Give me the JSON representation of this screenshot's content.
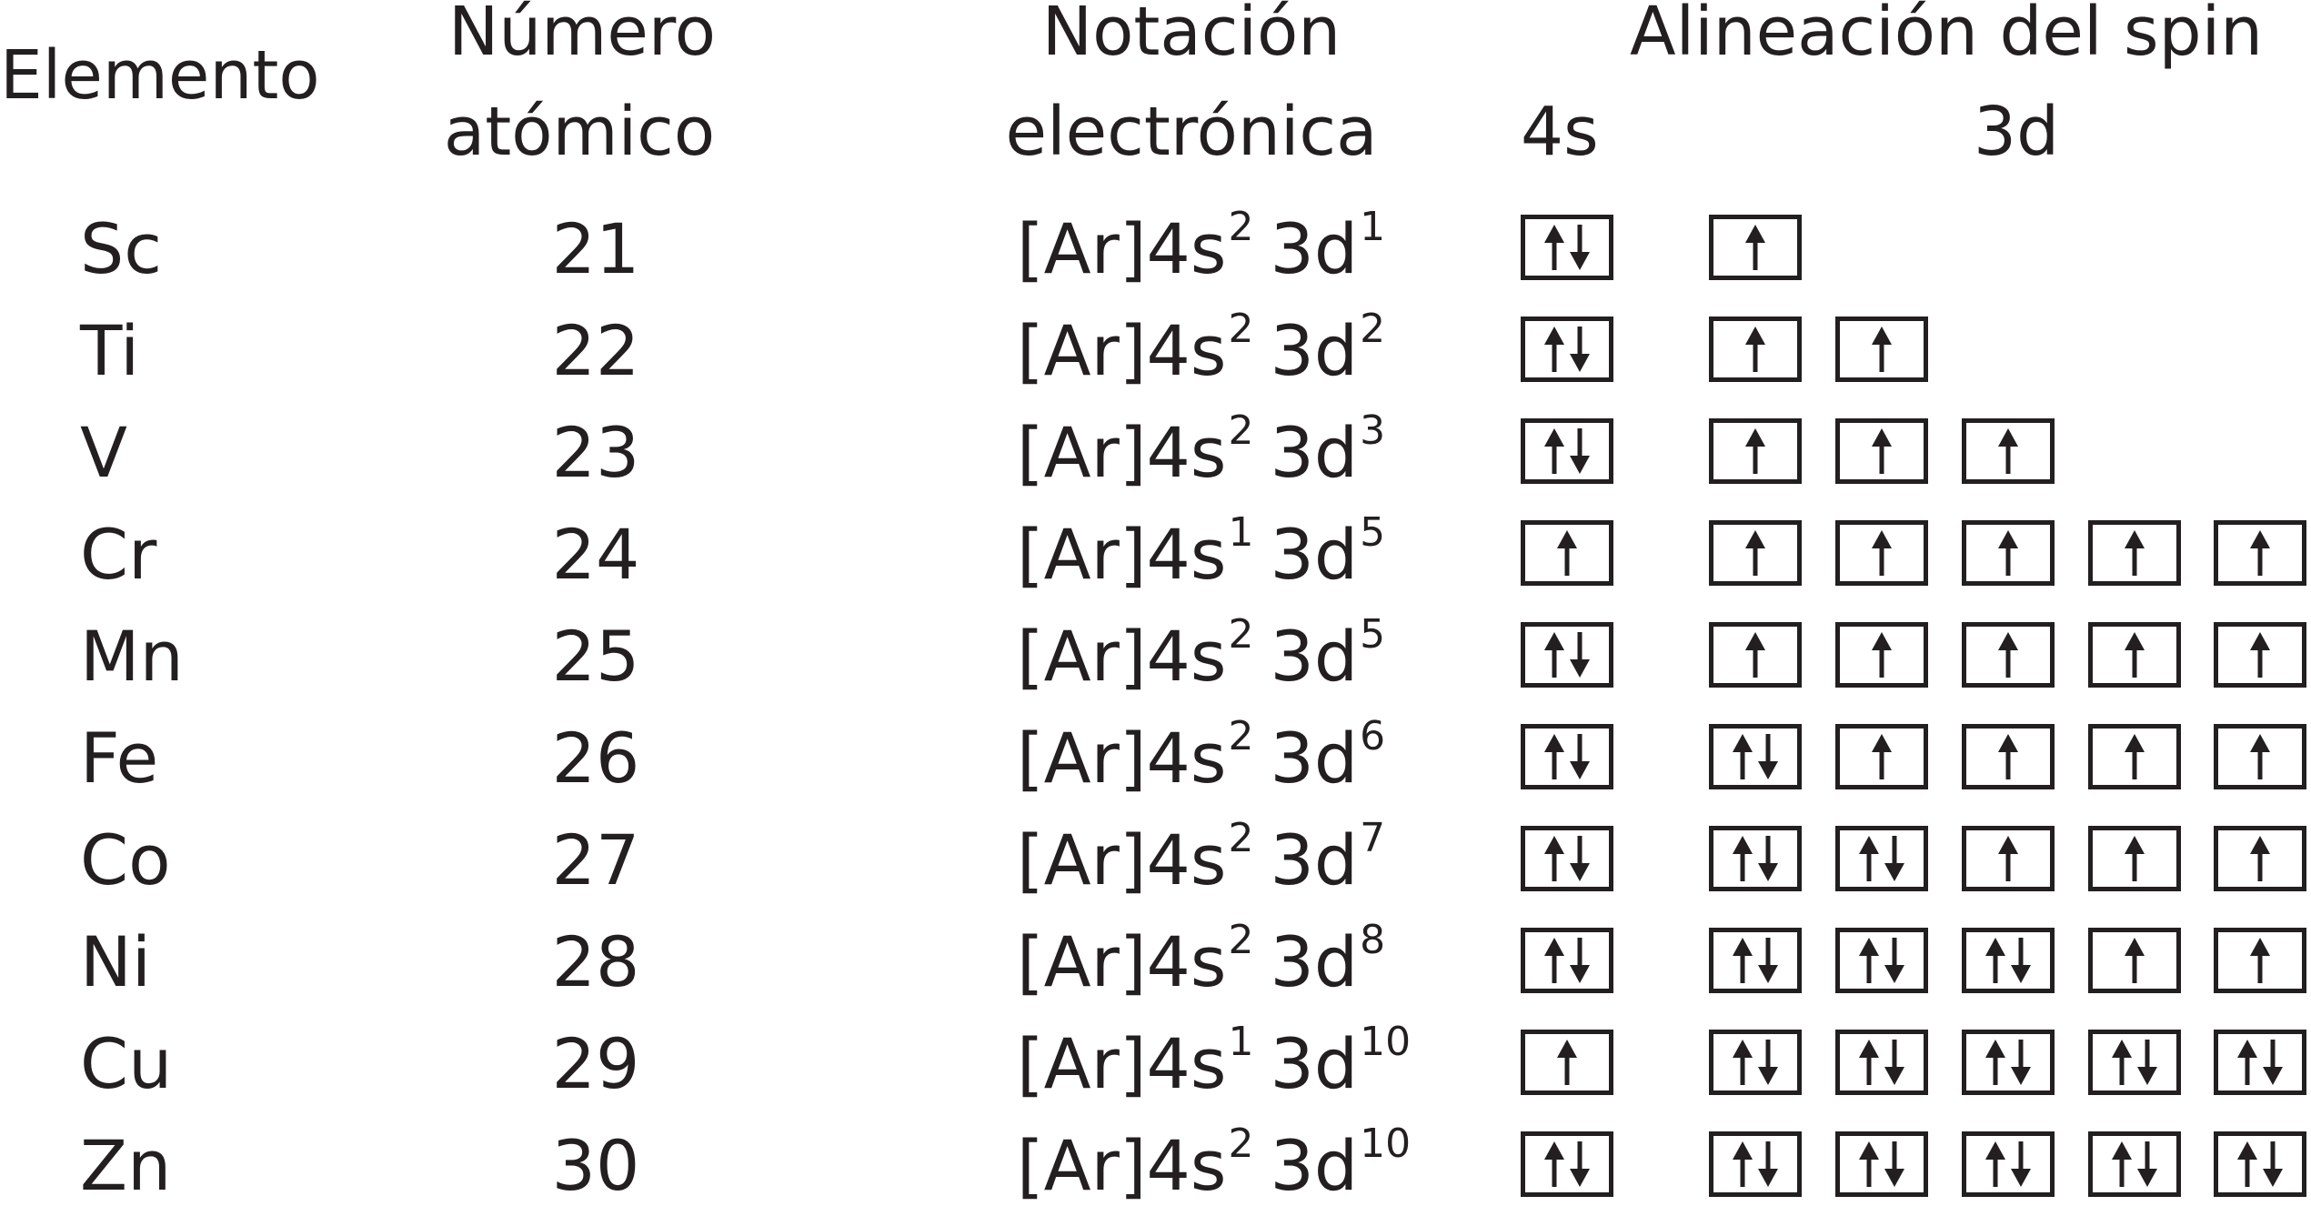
{
  "headers": {
    "element": "Elemento",
    "atomic_number": [
      "Número",
      "atómico"
    ],
    "notation": [
      "Notación",
      "electrónica"
    ],
    "spin": "Alineación del spin",
    "sub_4s": "4s",
    "sub_3d": "3d"
  },
  "rows": [
    {
      "symbol": "Sc",
      "number": "21",
      "notation": {
        "base": "[Ar]4s",
        "s_exp": "2",
        "d": "3d",
        "d_exp": "1"
      },
      "s4": 2,
      "d3": [
        1
      ]
    },
    {
      "symbol": "Ti",
      "number": "22",
      "notation": {
        "base": "[Ar]4s",
        "s_exp": "2",
        "d": "3d",
        "d_exp": "2"
      },
      "s4": 2,
      "d3": [
        1,
        1
      ]
    },
    {
      "symbol": "V",
      "number": "23",
      "notation": {
        "base": "[Ar]4s",
        "s_exp": "2",
        "d": "3d",
        "d_exp": "3"
      },
      "s4": 2,
      "d3": [
        1,
        1,
        1
      ]
    },
    {
      "symbol": "Cr",
      "number": "24",
      "notation": {
        "base": "[Ar]4s",
        "s_exp": "1",
        "d": "3d",
        "d_exp": "5"
      },
      "s4": 1,
      "d3": [
        1,
        1,
        1,
        1,
        1
      ]
    },
    {
      "symbol": "Mn",
      "number": "25",
      "notation": {
        "base": "[Ar]4s",
        "s_exp": "2",
        "d": "3d",
        "d_exp": "5"
      },
      "s4": 2,
      "d3": [
        1,
        1,
        1,
        1,
        1
      ]
    },
    {
      "symbol": "Fe",
      "number": "26",
      "notation": {
        "base": "[Ar]4s",
        "s_exp": "2",
        "d": "3d",
        "d_exp": "6"
      },
      "s4": 2,
      "d3": [
        2,
        1,
        1,
        1,
        1
      ]
    },
    {
      "symbol": "Co",
      "number": "27",
      "notation": {
        "base": "[Ar]4s",
        "s_exp": "2",
        "d": "3d",
        "d_exp": "7"
      },
      "s4": 2,
      "d3": [
        2,
        2,
        1,
        1,
        1
      ]
    },
    {
      "symbol": "Ni",
      "number": "28",
      "notation": {
        "base": "[Ar]4s",
        "s_exp": "2",
        "d": "3d",
        "d_exp": "8"
      },
      "s4": 2,
      "d3": [
        2,
        2,
        2,
        1,
        1
      ]
    },
    {
      "symbol": "Cu",
      "number": "29",
      "notation": {
        "base": "[Ar]4s",
        "s_exp": "1",
        "d": "3d",
        "d_exp": "10"
      },
      "s4": 1,
      "d3": [
        2,
        2,
        2,
        2,
        2
      ]
    },
    {
      "symbol": "Zn",
      "number": "30",
      "notation": {
        "base": "[Ar]4s",
        "s_exp": "2",
        "d": "3d",
        "d_exp": "10"
      },
      "s4": 2,
      "d3": [
        2,
        2,
        2,
        2,
        2
      ]
    }
  ],
  "colors": {
    "ink": "#231f20",
    "background": "#ffffff"
  }
}
